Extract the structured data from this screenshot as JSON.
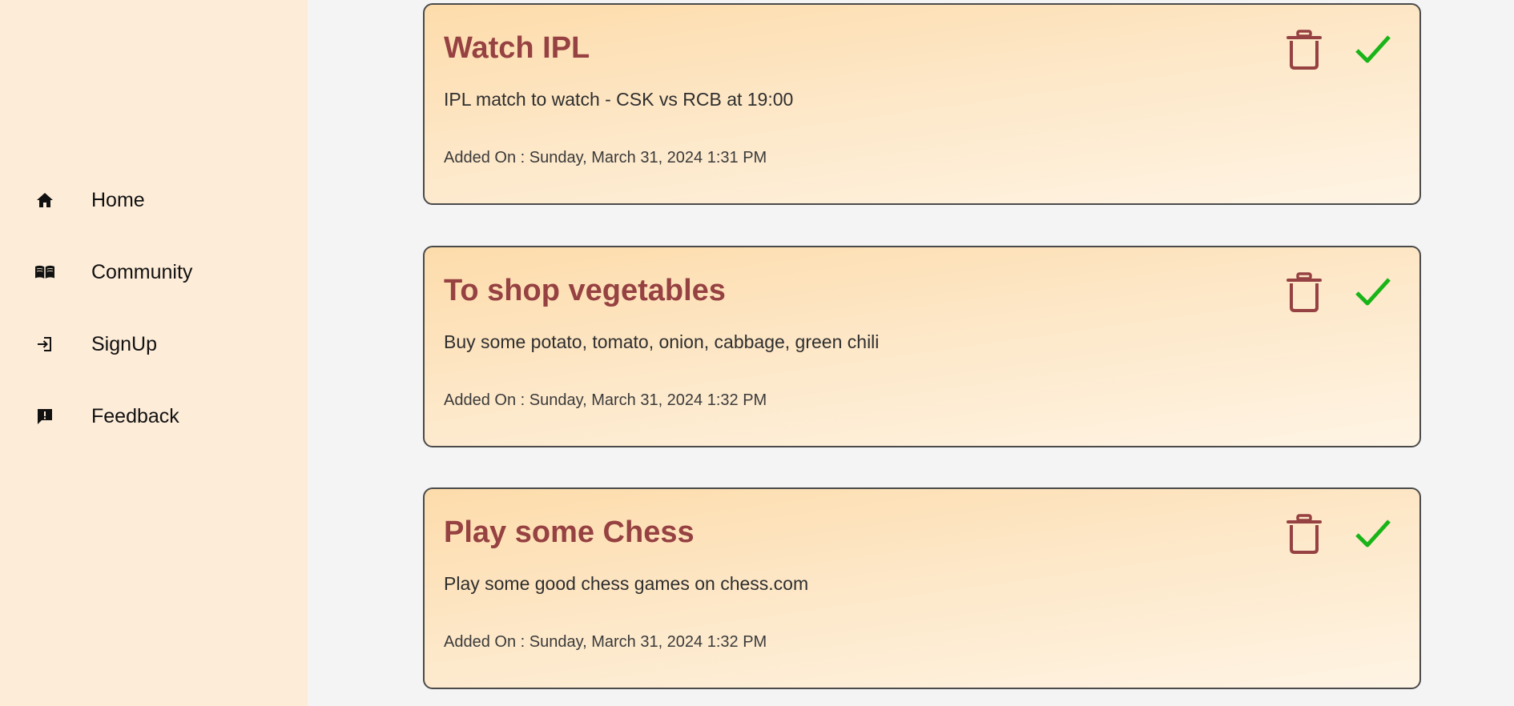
{
  "colors": {
    "sidebar_bg": "#fdecd8",
    "page_bg": "#f4f4f4",
    "title": "#964142",
    "delete_icon": "#964142",
    "check_icon": "#18b418"
  },
  "sidebar": {
    "items": [
      {
        "label": "Home",
        "icon": "home-icon"
      },
      {
        "label": "Community",
        "icon": "book-icon"
      },
      {
        "label": "SignUp",
        "icon": "login-icon"
      },
      {
        "label": "Feedback",
        "icon": "feedback-icon"
      }
    ]
  },
  "todos": [
    {
      "title": "Watch IPL",
      "description": "IPL match to watch - CSK vs RCB at 19:00",
      "added_on": "Added On : Sunday, March 31, 2024 1:31 PM",
      "delete_icon": "trash-icon",
      "complete_icon": "check-icon"
    },
    {
      "title": "To shop vegetables",
      "description": "Buy some potato, tomato, onion, cabbage, green chili",
      "added_on": "Added On : Sunday, March 31, 2024 1:32 PM",
      "delete_icon": "trash-icon",
      "complete_icon": "check-icon"
    },
    {
      "title": "Play some Chess",
      "description": "Play some good chess games on chess.com",
      "added_on": "Added On : Sunday, March 31, 2024 1:32 PM",
      "delete_icon": "trash-icon",
      "complete_icon": "check-icon"
    }
  ]
}
